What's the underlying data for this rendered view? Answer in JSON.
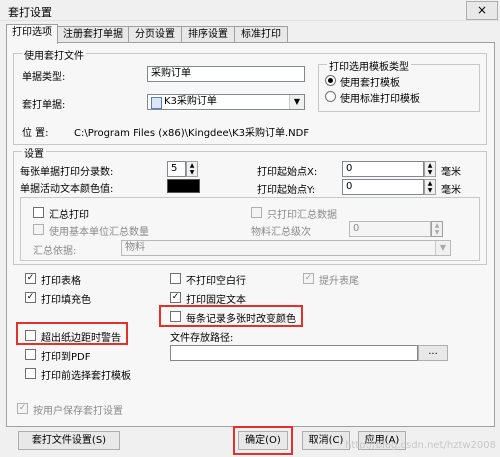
{
  "window": {
    "title": "套打设置",
    "close_label": "×"
  },
  "tabs": [
    "打印选项",
    "注册套打单据",
    "分页设置",
    "排序设置",
    "标准打印"
  ],
  "use_file": {
    "group_label": "使用套打文件",
    "doc_type_label": "单据类型:",
    "doc_type_value": "采购订单",
    "doc_label": "套打单据:",
    "doc_value": "K3采购订单",
    "location_label": "位    置:",
    "location_value": "C:\\Program Files (x86)\\Kingdee\\K3采购订单.NDF"
  },
  "template_type": {
    "group_label": "打印选用模板类型",
    "options": [
      "使用套打模板",
      "使用标准打印模板"
    ],
    "selected": 0
  },
  "settings": {
    "group_label": "设置",
    "per_page_label": "每张单据打印分录数:",
    "per_page_value": "5",
    "color_label": "单据活动文本颜色值:",
    "start_x_label": "打印起始点X:",
    "start_x_value": "0",
    "start_y_label": "打印起始点Y:",
    "start_y_value": "0",
    "unit_mm": "毫米",
    "summary_print": "汇总打印",
    "only_summary": "只打印汇总数据",
    "use_basic_unit": "使用基本单位汇总数量",
    "material_level_label": "物料汇总级次",
    "material_level_value": "0",
    "summary_basis_label": "汇总依据:",
    "summary_basis_value": "物料"
  },
  "options": {
    "print_table": "打印表格",
    "no_blank_rows": "不打印空白行",
    "raise_footer": "提升表尾",
    "print_fill": "打印填充色",
    "print_fixed_text": "打印固定文本",
    "change_color": "每条记录多张时改变颜色",
    "exceed_warning": "超出纸边距时警告",
    "file_path_label": "文件存放路径:",
    "browse_label": "...",
    "print_pdf": "打印到PDF",
    "select_template": "打印前选择套打模板",
    "save_by_user": "按用户保存套打设置"
  },
  "checks": {
    "summary_print": false,
    "only_summary": false,
    "use_basic_unit": false,
    "print_table": true,
    "no_blank_rows": false,
    "raise_footer": true,
    "print_fill": true,
    "print_fixed_text": true,
    "change_color": false,
    "exceed_warning": false,
    "print_pdf": false,
    "select_template": false,
    "save_by_user": true
  },
  "buttons": {
    "template_settings": "套打文件设置(S)",
    "ok": "确定(O)",
    "cancel": "取消(C)",
    "apply": "应用(A)"
  },
  "watermark": "http://blog.csdn.net/hztw2008",
  "highlight_color": "#e0312d"
}
